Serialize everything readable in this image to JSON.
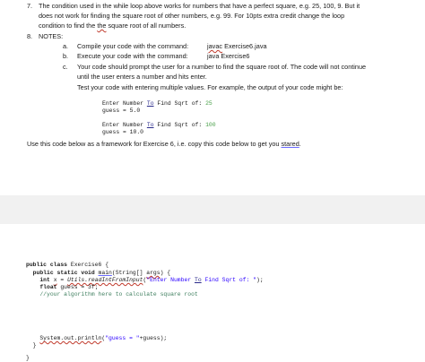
{
  "items": {
    "seven_num": "7.",
    "seven_l1": "The condition used in the while loop above works for numbers that have a perfect square, e.g. 25, 100, 9. But it",
    "seven_l2": "does not work for finding the square root of other numbers, e.g. 99.  For 10pts extra credit change the loop",
    "seven_l3a": "condition to find the ",
    "seven_l3b": "the",
    "seven_l3c": " square root of all numbers.",
    "eight_num": "8.",
    "eight_label": "NOTES:",
    "a_mark": "a.",
    "a_text": "Compile your code with the command:",
    "a_cmd_a": "javac",
    "a_cmd_b": " Exercise6.java",
    "b_mark": "b.",
    "b_text": "Execute your code with the command:",
    "b_cmd": "java Exercise6",
    "c_mark": "c.",
    "c_l1": "Your code should prompt the user for a number to find the square root of. The code will not continue",
    "c_l2": "until the user enters a number and hits enter.",
    "c_l3": "Test your code with entering multiple values. For example, the output of your code might be:"
  },
  "examples": {
    "ex1_prompt_a": "Enter Number ",
    "ex1_prompt_to": "To",
    "ex1_prompt_b": " Find Sqrt of: ",
    "ex1_value": "25",
    "ex1_guess": "guess = 5.0",
    "ex2_prompt_a": "Enter Number ",
    "ex2_prompt_to": "To",
    "ex2_prompt_b": " Find Sqrt of: ",
    "ex2_value": "100",
    "ex2_guess": "guess = 10.0"
  },
  "instruction": {
    "text_a": "Use this code below as a framework for Exercise 6, i.e. copy this code below to get you ",
    "text_b": "stared",
    "text_c": "."
  },
  "code": {
    "l1_kw": "public class",
    "l1_rest": " Exercise6 {",
    "l2_kw": "  public static void",
    "l2_a": " ",
    "l2_main": "main",
    "l2_b": "(String[] ",
    "l2_args": "args",
    "l2_c": ") {",
    "l3_kw": "    int",
    "l3_a": " ",
    "l3_x": "x",
    "l3_b": " = ",
    "l3_utils": "Utils.readIntFromInput",
    "l3_c": "(",
    "l3_str_a": "\"Enter Number ",
    "l3_str_to": "To",
    "l3_str_b": " Find Sqrt of: \"",
    "l3_d": ");",
    "l4_kw": "    float",
    "l4_rest": " guess = 3f;",
    "l5_comment": "    //your algorithm here to calculate square root",
    "l6_a": "    ",
    "l6_sys": "System.out.println",
    "l6_b": "(",
    "l6_str": "\"guess = \"",
    "l6_c": "+guess);",
    "l7": "  }",
    "l8": "}"
  },
  "colors": {
    "keyword": "#1a1a1a",
    "comment": "#3f7f5f",
    "string": "#2a00ff",
    "console_input": "#4aa04a"
  }
}
